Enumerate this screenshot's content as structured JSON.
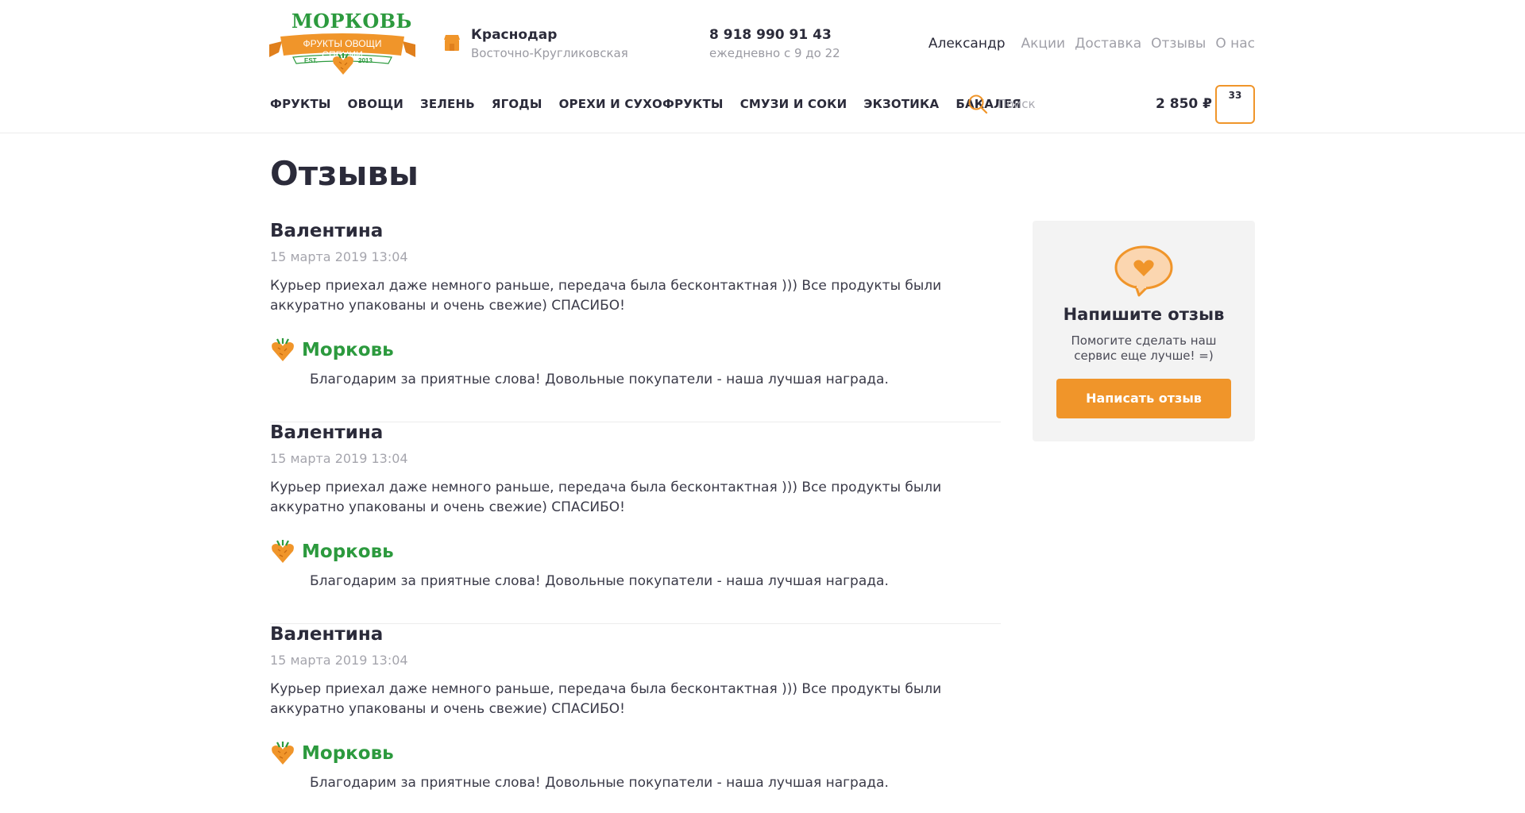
{
  "brand": {
    "title": "МОРКОВЬ",
    "subtitle": "ФРУКТЫ ОВОЩИ СПЕЦИИ",
    "est": "EST.",
    "year": "2013",
    "green": "#2c9a3e",
    "orange": "#f0952a"
  },
  "location": {
    "city": "Краснодар",
    "street": "Восточно-Кругликовская"
  },
  "contact": {
    "phone": "8 918 990 91 43",
    "hours": "ежедневно с 9 до 22"
  },
  "user_nav": {
    "user": "Александр",
    "links": [
      "Акции",
      "Доставка",
      "Отзывы",
      "О нас"
    ]
  },
  "categories": [
    "ФРУКТЫ",
    "ОВОЩИ",
    "ЗЕЛЕНЬ",
    "ЯГОДЫ",
    "ОРЕХИ И СУХОФРУКТЫ",
    "СМУЗИ И СОКИ",
    "ЭКЗОТИКА",
    "БАКАЛЕЯ"
  ],
  "search": {
    "placeholder": "Поиск"
  },
  "cart": {
    "total": "2 850 ₽",
    "count": "33"
  },
  "page": {
    "title": "Отзывы"
  },
  "reviews": [
    {
      "author": "Валентина",
      "date": "15 марта 2019 13:04",
      "text": "Курьер приехал даже немного раньше, передача была бесконтактная ))) Все продукты были аккуратно упакованы и очень свежие) СПАСИБО!",
      "store": "Морковь",
      "reply": "Благодарим за приятные слова! Довольные покупатели - наша лучшая награда."
    },
    {
      "author": "Валентина",
      "date": "15 марта 2019 13:04",
      "text": "Курьер приехал даже немного раньше, передача была бесконтактная ))) Все продукты были аккуратно упакованы и очень свежие) СПАСИБО!",
      "store": "Морковь",
      "reply": "Благодарим за приятные слова! Довольные покупатели - наша лучшая награда."
    },
    {
      "author": "Валентина",
      "date": "15 марта 2019 13:04",
      "text": "Курьер приехал даже немного раньше, передача была бесконтактная ))) Все продукты были аккуратно упакованы и очень свежие) СПАСИБО!",
      "store": "Морковь",
      "reply": "Благодарим за приятные слова! Довольные покупатели - наша лучшая награда."
    }
  ],
  "sidebar": {
    "icon": "heart-speech-bubble-icon",
    "title": "Напишите отзыв",
    "text": "Помогите сделать наш сервис еще лучше! =)",
    "button": "Написать отзыв"
  }
}
